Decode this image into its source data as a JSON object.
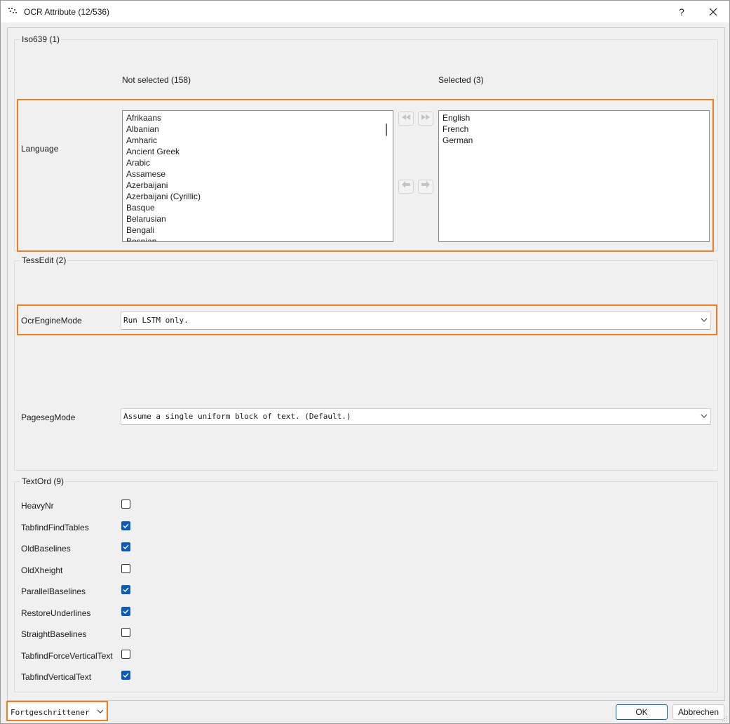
{
  "window": {
    "title": "OCR Attribute (12/536)",
    "help_label": "?"
  },
  "iso639": {
    "group_title": "Iso639 (1)",
    "not_selected_header": "Not selected (158)",
    "selected_header": "Selected (3)",
    "row_label": "Language",
    "not_selected_items": [
      "Afrikaans",
      "Albanian",
      "Amharic",
      "Ancient Greek",
      "Arabic",
      "Assamese",
      "Azerbaijani",
      "Azerbaijani (Cyrillic)",
      "Basque",
      "Belarusian",
      "Bengali",
      "Bosnian"
    ],
    "selected_items": [
      "English",
      "French",
      "German"
    ],
    "buttons": [
      "move-all-left",
      "move-all-right",
      "move-left",
      "move-right"
    ]
  },
  "tessedit": {
    "group_title": "TessEdit (2)",
    "ocr_engine_label": "OcrEngineMode",
    "ocr_engine_value": "Run LSTM only.",
    "pageseg_label": "PagesegMode",
    "pageseg_value": "Assume a single uniform block of text. (Default.)"
  },
  "textord": {
    "group_title": "TextOrd (9)",
    "options": [
      {
        "label": "HeavyNr",
        "checked": false
      },
      {
        "label": "TabfindFindTables",
        "checked": true
      },
      {
        "label": "OldBaselines",
        "checked": true
      },
      {
        "label": "OldXheight",
        "checked": false
      },
      {
        "label": "ParallelBaselines",
        "checked": true
      },
      {
        "label": "RestoreUnderlines",
        "checked": true
      },
      {
        "label": "StraightBaselines",
        "checked": false
      },
      {
        "label": "TabfindForceVerticalText",
        "checked": false
      },
      {
        "label": "TabfindVerticalText",
        "checked": true
      }
    ]
  },
  "footer": {
    "mode_value": "Fortgeschrittener",
    "ok_label": "OK",
    "cancel_label": "Abbrechen"
  },
  "colors": {
    "highlight": "#f07e22",
    "accent": "#0b5cb8"
  }
}
